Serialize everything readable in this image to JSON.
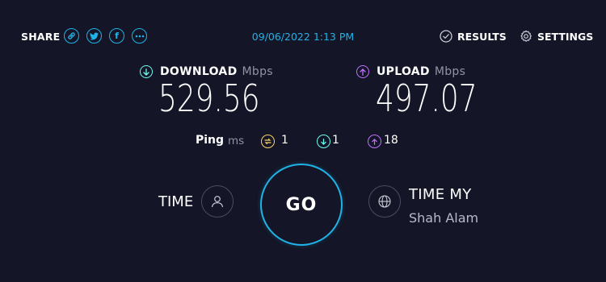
{
  "share": {
    "label": "SHARE",
    "buttons": [
      {
        "icon": "link-icon"
      },
      {
        "icon": "twitter-icon"
      },
      {
        "icon": "facebook-icon"
      },
      {
        "icon": "more-icon"
      }
    ]
  },
  "timestamp": "09/06/2022 1:13 PM",
  "nav": {
    "results_label": "RESULTS",
    "settings_label": "SETTINGS"
  },
  "download": {
    "label": "DOWNLOAD",
    "unit": "Mbps",
    "value": "529.56",
    "icon": "arrow-down-circle-icon",
    "color": "#6afff3"
  },
  "upload": {
    "label": "UPLOAD",
    "unit": "Mbps",
    "value": "497.07",
    "icon": "arrow-up-circle-icon",
    "color": "#bf71ff"
  },
  "ping": {
    "label": "Ping",
    "unit": "ms",
    "idle": {
      "value": "1",
      "icon": "ping-idle-icon",
      "color": "#fbd46d"
    },
    "download": {
      "value": "1",
      "icon": "ping-download-icon",
      "color": "#6afff3"
    },
    "upload": {
      "value": "18",
      "icon": "ping-upload-icon",
      "color": "#bf71ff"
    }
  },
  "go": {
    "label": "GO"
  },
  "isp": {
    "name": "TIME",
    "icon": "user-icon"
  },
  "server": {
    "name": "TIME MY",
    "location": "Shah Alam",
    "icon": "globe-icon"
  },
  "colors": {
    "background": "#141526",
    "accent": "#1fb3e8"
  }
}
